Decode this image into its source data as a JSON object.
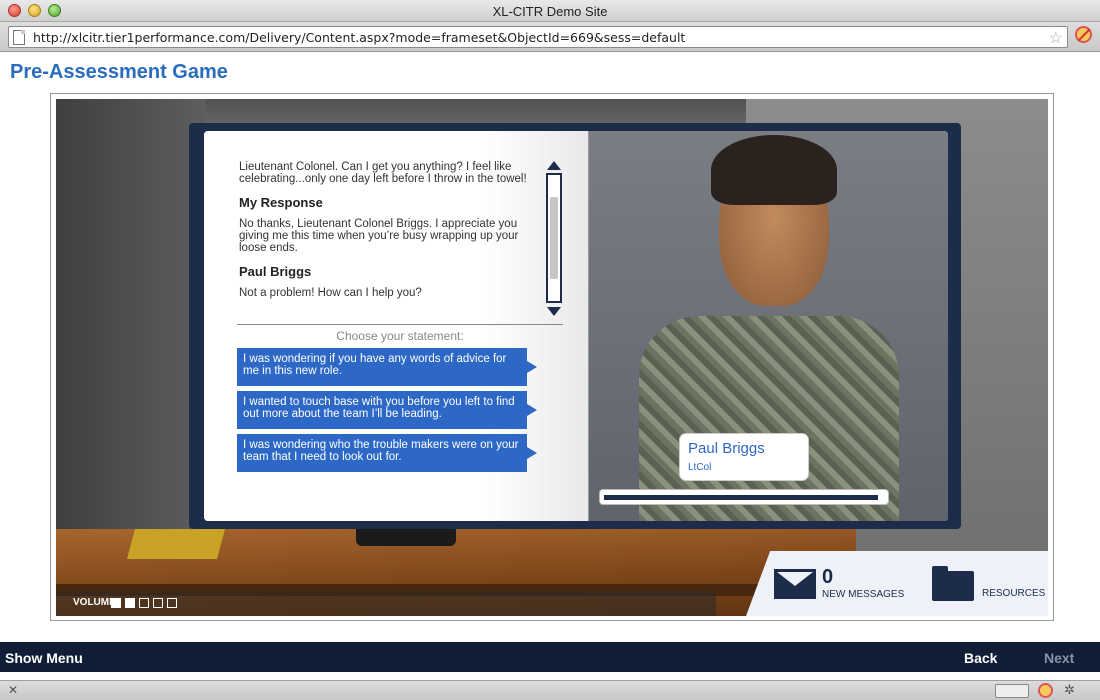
{
  "browser": {
    "window_title": "XL-CITR Demo Site",
    "url": "http://xlcitr.tier1performance.com/Delivery/Content.aspx?mode=frameset&ObjectId=669&sess=default"
  },
  "page": {
    "title": "Pre-Assessment Game"
  },
  "dialog": {
    "transcript": [
      {
        "type": "text",
        "text": "Lieutenant Colonel. Can I get you anything? I feel like celebrating...only one day left before I throw in the towel!"
      },
      {
        "type": "speaker",
        "text": "My Response"
      },
      {
        "type": "text",
        "text": "No thanks, Lieutenant Colonel Briggs. I appreciate you giving me this time when you’re busy wrapping up your loose ends."
      },
      {
        "type": "speaker",
        "text": "Paul Briggs"
      },
      {
        "type": "text",
        "text": "Not a problem! How can I help you?"
      }
    ],
    "choose_label": "Choose your statement:",
    "choices": [
      "I was wondering if you have any words of advice for me in this new role.",
      "I wanted to touch base with you before you left to find out more about the team I’ll be leading.",
      "I was wondering who the trouble makers were on your team that I need to look out for."
    ]
  },
  "character": {
    "name": "Paul Briggs",
    "rank": "LtCol",
    "progress": 0.98
  },
  "hud": {
    "volume_label": "VOLUME",
    "volume_level": 2,
    "volume_steps": 5,
    "message_count": "0",
    "messages_label": "NEW MESSAGES",
    "resources_label": "RESOURCES"
  },
  "nav": {
    "show_menu": "Show Menu",
    "back": "Back",
    "next": "Next"
  },
  "icons": {
    "page": "page-icon",
    "bookmark": "star-icon",
    "block": "block-icon",
    "mail": "mail-icon",
    "folder": "folder-icon"
  },
  "colors": {
    "title_blue": "#2a6dbd",
    "choice_blue": "#2d68c6",
    "navy": "#1c2c4a",
    "navbar": "#0f1d36"
  }
}
